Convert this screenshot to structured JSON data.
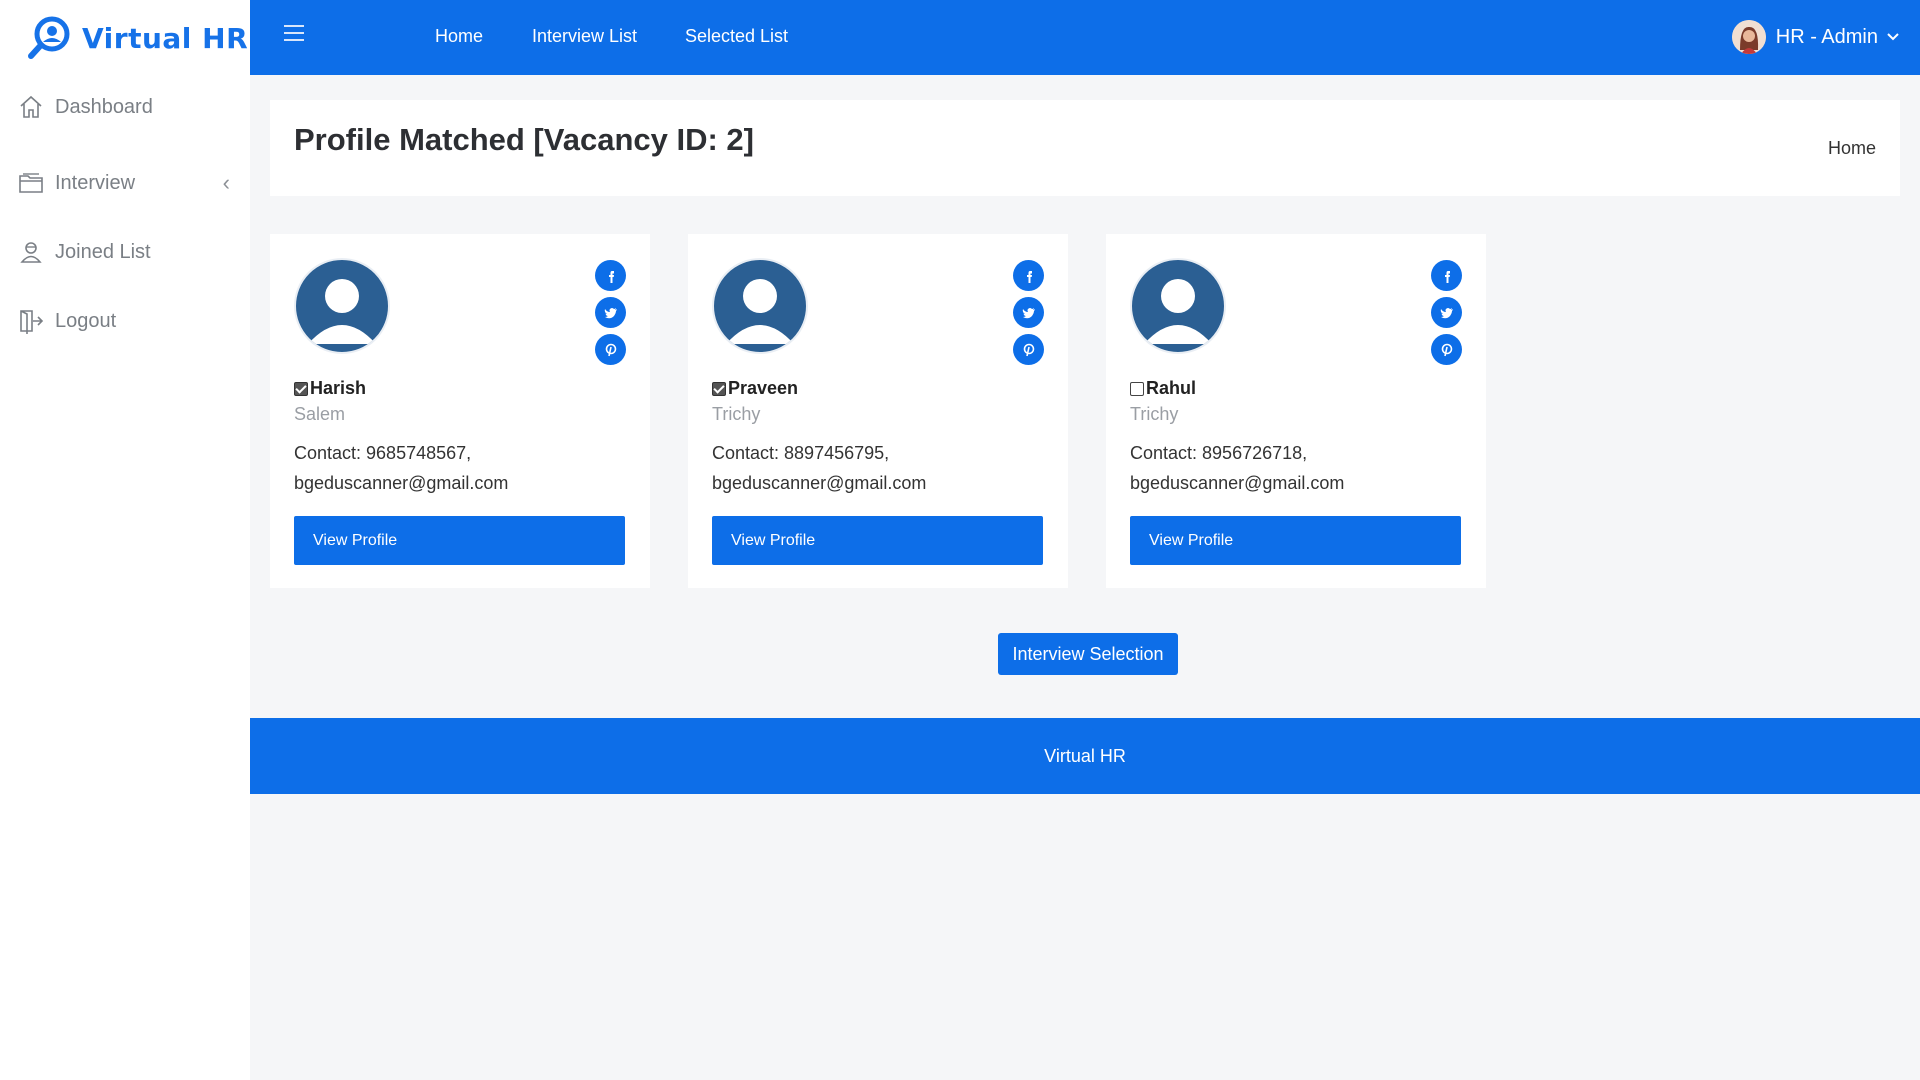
{
  "app": {
    "name": "Virtual HR"
  },
  "sidebar": {
    "items": [
      {
        "label": "Dashboard",
        "icon": "home-icon"
      },
      {
        "label": "Interview",
        "icon": "folder-icon",
        "has_chevron": true
      },
      {
        "label": "Joined List",
        "icon": "person-icon"
      },
      {
        "label": "Logout",
        "icon": "logout-icon"
      }
    ]
  },
  "topbar": {
    "links": [
      "Home",
      "Interview List",
      "Selected List"
    ],
    "user": "HR - Admin"
  },
  "header": {
    "title": "Profile Matched [Vacancy ID: 2]",
    "breadcrumb": "Home"
  },
  "profiles": [
    {
      "name": "Harish",
      "city": "Salem",
      "contact": "Contact: 9685748567,",
      "email": "bgeduscanner@gmail.com",
      "checked": true,
      "button": "View Profile"
    },
    {
      "name": "Praveen",
      "city": "Trichy",
      "contact": "Contact: 8897456795,",
      "email": "bgeduscanner@gmail.com",
      "checked": true,
      "button": "View Profile"
    },
    {
      "name": "Rahul",
      "city": "Trichy",
      "contact": "Contact: 8956726718,",
      "email": "bgeduscanner@gmail.com",
      "checked": false,
      "button": "View Profile"
    }
  ],
  "actions": {
    "interview_selection": "Interview Selection"
  },
  "footer": {
    "text": "Virtual HR"
  },
  "colors": {
    "primary": "#0d6ee8",
    "avatar": "#2b5f93",
    "background": "#f5f6f8"
  }
}
